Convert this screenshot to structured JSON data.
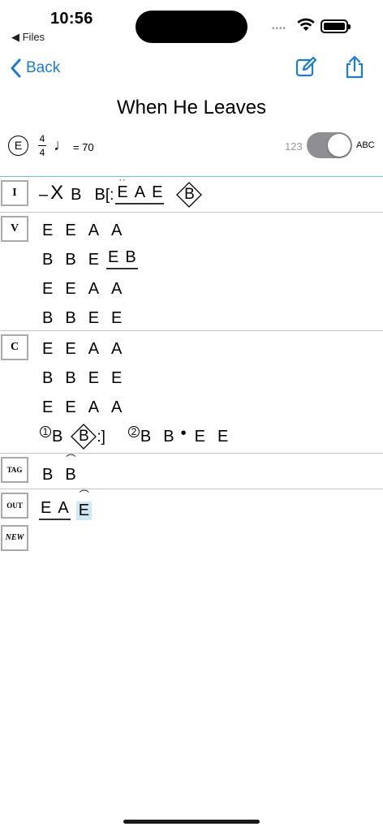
{
  "status_bar": {
    "time": "10:56",
    "back_app": "◀ Files"
  },
  "nav": {
    "back_label": "Back",
    "accent_color": "#1a7cd9",
    "icons": [
      "compose-icon",
      "share-icon"
    ]
  },
  "song": {
    "title": "When He Leaves",
    "key": "E",
    "time_sig_top": "4",
    "time_sig_bottom": "4",
    "tempo": "= 70"
  },
  "display_toggle": {
    "left_label": "123",
    "right_label": "ABC",
    "state": "ABC"
  },
  "sections": [
    {
      "tag": "I",
      "lines": [
        [
          "–",
          "X",
          "B",
          "B",
          "E",
          "A",
          "E",
          "B"
        ]
      ]
    },
    {
      "tag": "V",
      "lines": [
        [
          "E",
          "E",
          "A",
          "A"
        ],
        [
          "B",
          "B",
          "E",
          "E",
          "B"
        ],
        [
          "E",
          "E",
          "A",
          "A"
        ],
        [
          "B",
          "B",
          "E",
          "E"
        ]
      ]
    },
    {
      "tag": "C",
      "lines": [
        [
          "E",
          "E",
          "A",
          "A"
        ],
        [
          "B",
          "B",
          "E",
          "E"
        ],
        [
          "E",
          "E",
          "A",
          "A"
        ],
        [
          "1",
          "B",
          "B",
          "2",
          "B",
          "B",
          "E",
          "E"
        ]
      ]
    },
    {
      "tag": "TAG",
      "lines": [
        [
          "B",
          "B"
        ]
      ]
    },
    {
      "tag": "OUT",
      "lines": [
        [
          "E",
          "A",
          "E"
        ]
      ]
    },
    {
      "tag": "NEW",
      "lines": []
    }
  ]
}
